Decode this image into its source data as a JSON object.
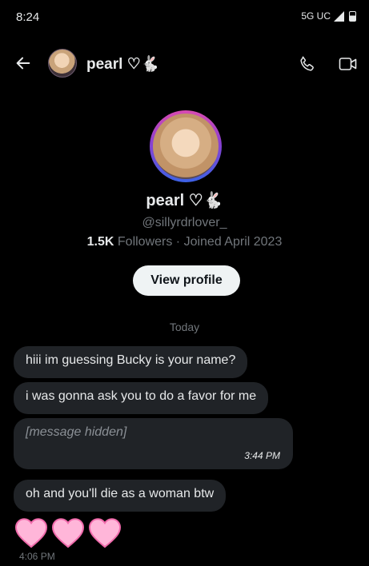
{
  "status_bar": {
    "time": "8:24",
    "network": "5G UC"
  },
  "header": {
    "name": "pearl ♡🐇"
  },
  "profile": {
    "name": "pearl ♡🐇",
    "handle": "@sillyrdrlover_",
    "followers_count": "1.5K",
    "followers_rest": " Followers · Joined April 2023",
    "view_profile_label": "View profile"
  },
  "conversation": {
    "date_label": "Today",
    "messages": [
      {
        "text": "hiii im guessing Bucky is your name?"
      },
      {
        "text": "i was gonna ask you to do a favor for me"
      },
      {
        "text": "[message hidden]",
        "time": "3:44 PM"
      },
      {
        "text": "oh and you'll die as a woman btw"
      }
    ],
    "last_time": "4:06 PM"
  },
  "colors": {
    "bubble": "#202327",
    "heart_fill": "#ffb6d9",
    "heart_outline": "#f06aab"
  },
  "icons": [
    "back-arrow-icon",
    "phone-icon",
    "video-icon",
    "heart-icon"
  ]
}
